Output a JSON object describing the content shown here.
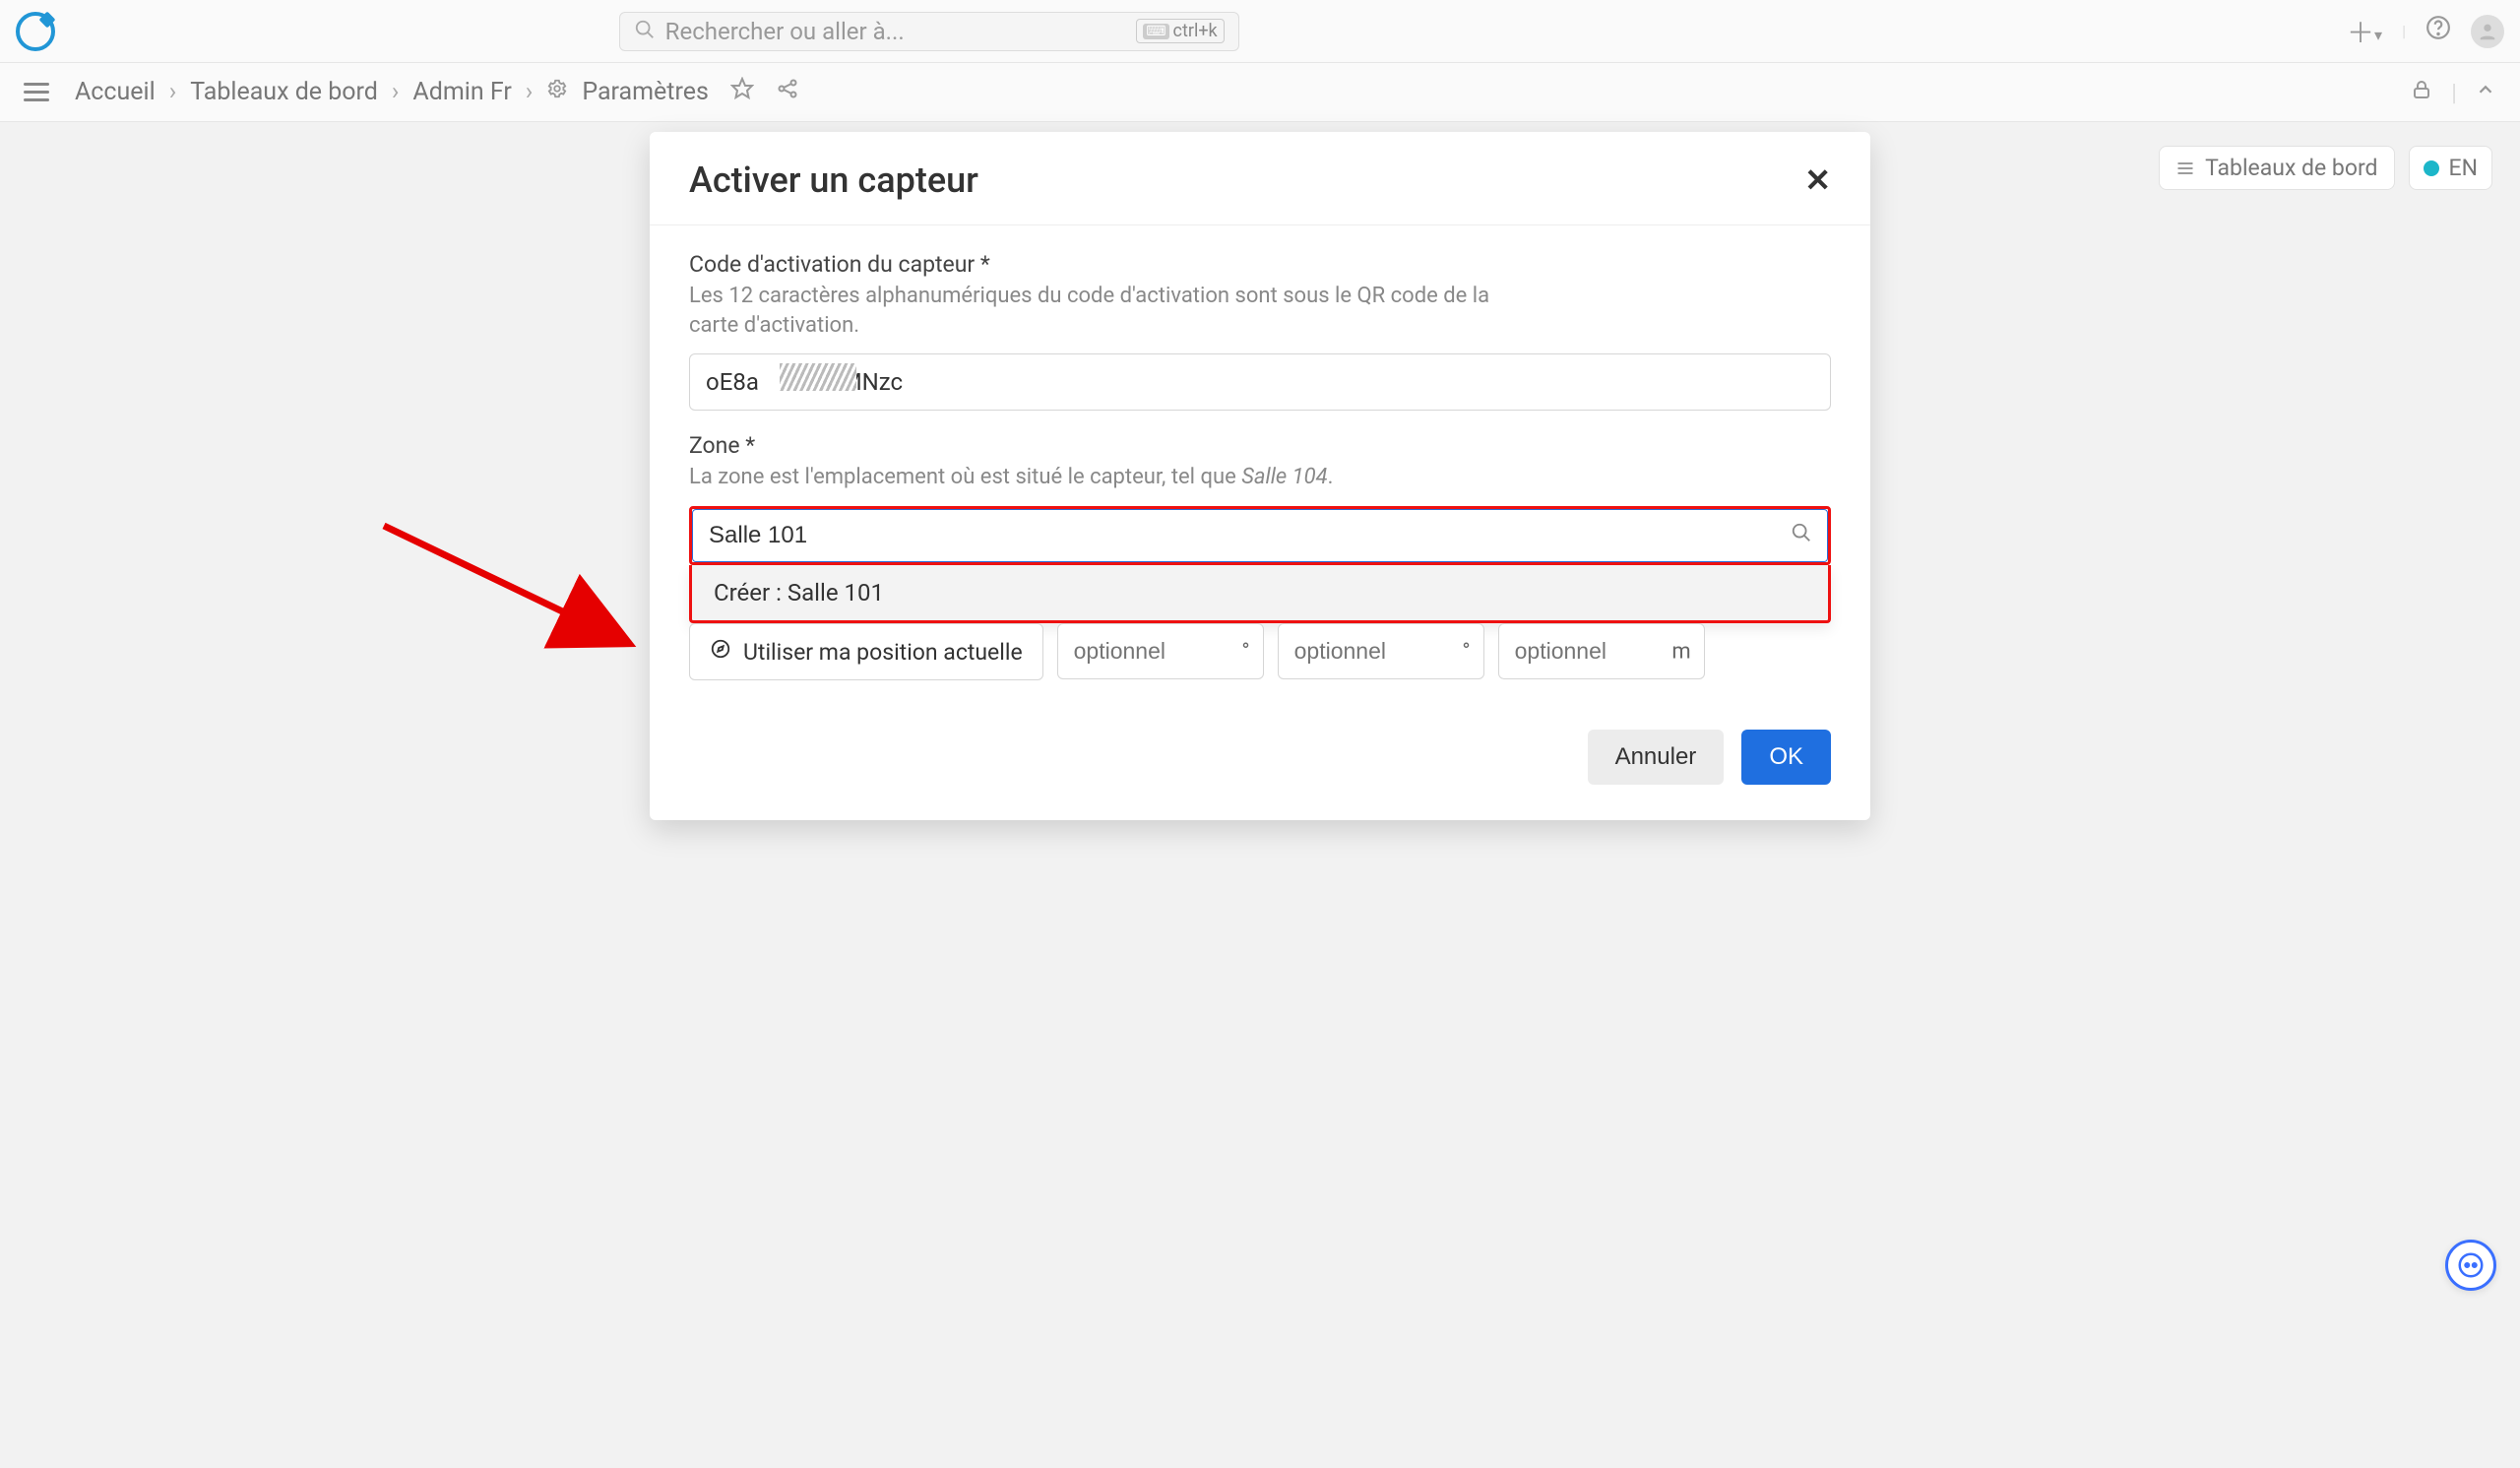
{
  "topbar": {
    "search_placeholder": "Rechercher ou aller à...",
    "shortcut_label": "ctrl+k"
  },
  "breadcrumb": {
    "items": [
      "Accueil",
      "Tableaux de bord",
      "Admin Fr",
      "Paramètres"
    ]
  },
  "page_toolbar": {
    "dashboards_label": "Tableaux de bord",
    "lang_label": "EN"
  },
  "modal": {
    "title": "Activer un capteur",
    "code": {
      "label": "Code d'activation du capteur *",
      "hint": "Les 12 caractères alphanumériques du code d'activation sont sous le QR code de la carte d'activation.",
      "value_prefix": "oE8a",
      "value_suffix": "MNzc"
    },
    "zone": {
      "label": "Zone *",
      "hint_prefix": "La zone est l'emplacement où est situé le capteur, tel que ",
      "hint_example": "Salle 104",
      "value": "Salle 101",
      "dropdown_create": "Créer : Salle 101"
    },
    "geo": {
      "button": "Utiliser ma position actuelle",
      "lat_placeholder": "optionnel",
      "lat_unit": "°",
      "lon_placeholder": "optionnel",
      "lon_unit": "°",
      "alt_placeholder": "optionnel",
      "alt_unit": "m"
    },
    "buttons": {
      "cancel": "Annuler",
      "ok": "OK"
    }
  }
}
